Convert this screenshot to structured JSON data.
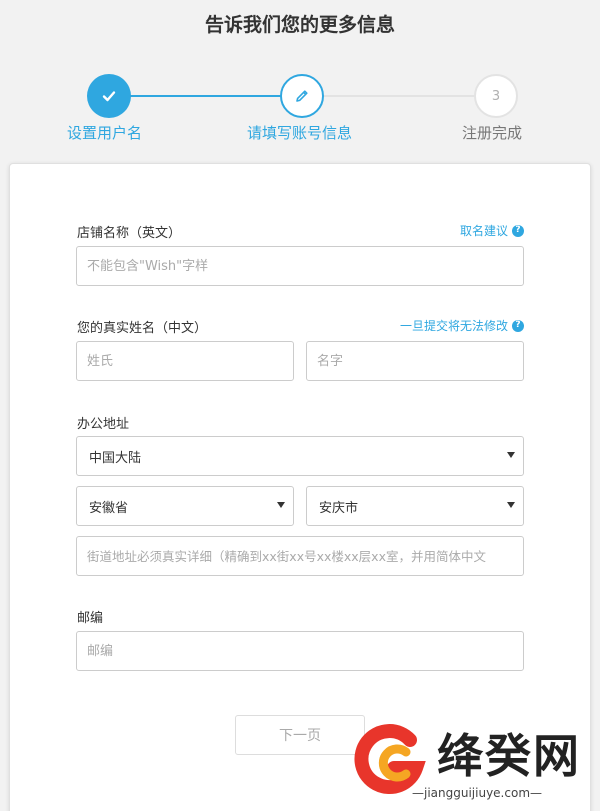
{
  "page": {
    "title": "告诉我们您的更多信息"
  },
  "stepper": {
    "steps": [
      {
        "label": "设置用户名",
        "state": "done"
      },
      {
        "label": "请填写账号信息",
        "state": "active"
      },
      {
        "label": "注册完成",
        "state": "todo",
        "number": "3"
      }
    ],
    "accent_color": "#2fa7e0"
  },
  "form": {
    "store_name": {
      "label": "店铺名称（英文）",
      "hint": "取名建议",
      "placeholder": "不能包含\"Wish\"字样",
      "value": ""
    },
    "real_name": {
      "label": "您的真实姓名（中文）",
      "hint": "一旦提交将无法修改",
      "surname_placeholder": "姓氏",
      "given_placeholder": "名字"
    },
    "address": {
      "label": "办公地址",
      "country": "中国大陆",
      "province": "安徽省",
      "city": "安庆市",
      "street_placeholder": "街道地址必须真实详细（精确到xx街xx号xx楼xx层xx室，并用简体中文"
    },
    "postcode": {
      "label": "邮编",
      "placeholder": "邮编"
    },
    "next_label": "下一页"
  },
  "watermark": {
    "text": "绛癸网",
    "url": "—jiangguijiuye.com—"
  }
}
